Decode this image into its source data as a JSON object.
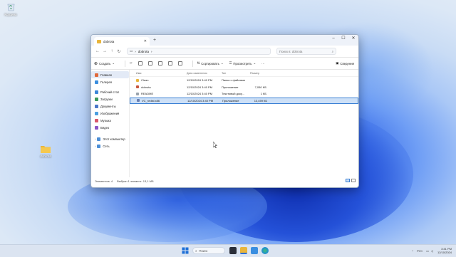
{
  "desktop": {
    "recycle_bin_label": "Корзина",
    "folder_label": "dobrota"
  },
  "window": {
    "tab_title": "dobrota",
    "address_path": "dobrota",
    "search_placeholder": "Поиск в: dobrota",
    "commands": {
      "create": "Создать",
      "sort": "Сортировать",
      "view": "Просмотреть",
      "details": "Сведения"
    },
    "sidebar": {
      "items": [
        {
          "label": "Главная",
          "icon": "home-icon",
          "color": "#e0693a"
        },
        {
          "label": "Галерея",
          "icon": "gallery-icon",
          "color": "#3b8ede"
        },
        {
          "label": "Рабочий стол",
          "icon": "desktop-icon",
          "color": "#3c86d8"
        },
        {
          "label": "Загрузки",
          "icon": "downloads-icon",
          "color": "#3a9a5a"
        },
        {
          "label": "Документы",
          "icon": "documents-icon",
          "color": "#4a77c9"
        },
        {
          "label": "Изображения",
          "icon": "pictures-icon",
          "color": "#4a9fe0"
        },
        {
          "label": "Музыка",
          "icon": "music-icon",
          "color": "#d9566a"
        },
        {
          "label": "Видео",
          "icon": "videos-icon",
          "color": "#8a55c7"
        }
      ],
      "tree": [
        {
          "label": "Этот компьютер",
          "icon": "computer-icon"
        },
        {
          "label": "Сеть",
          "icon": "network-icon"
        }
      ]
    },
    "columns": [
      "Имя",
      "Дата изменения",
      "Тип",
      "Размер"
    ],
    "files": [
      {
        "name": "Clean",
        "date": "12/10/2024 3:40 PM",
        "type": "Папка с файлами",
        "size": "",
        "icon": "folder-icon",
        "color": "#e9b53b"
      },
      {
        "name": "dobrota",
        "date": "12/10/2024 3:40 PM",
        "type": "Приложение",
        "size": "7,050 KБ",
        "icon": "app-icon",
        "color": "#c8553d"
      },
      {
        "name": "README",
        "date": "12/10/2024 3:40 PM",
        "type": "Текстовый доку...",
        "size": "1 КБ",
        "icon": "text-file-icon",
        "color": "#9aa3ad"
      },
      {
        "name": "VC_redist.x86",
        "date": "12/10/2024 3:40 PM",
        "type": "Приложение",
        "size": "13,459 КБ",
        "icon": "installer-icon",
        "color": "#6a7fb0"
      }
    ],
    "status": {
      "count": "Элементов: 4",
      "selection": "Выбран 1 элемент: 13,1 МБ"
    }
  },
  "taskbar": {
    "search_label": "Поиск",
    "lang": "РУС",
    "time": "3:41 PM",
    "date": "12/10/2024"
  }
}
